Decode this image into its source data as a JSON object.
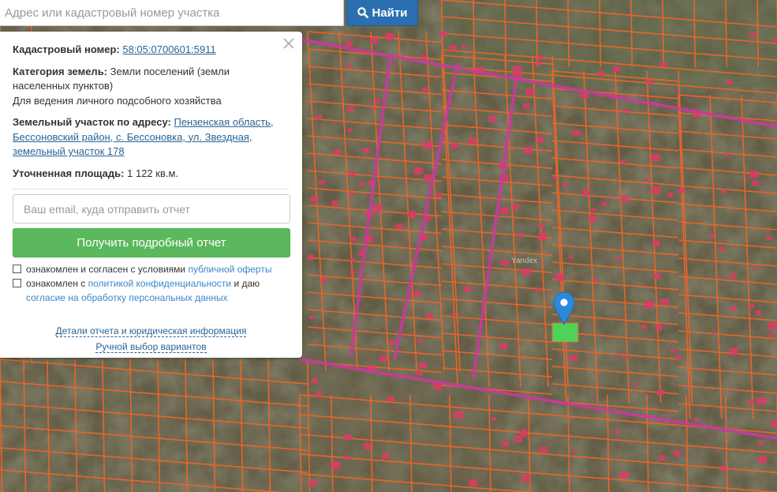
{
  "search": {
    "placeholder": "Адрес или кадастровый номер участка",
    "button_label": "Найти",
    "button_icon": "search-icon"
  },
  "info": {
    "cadastral_label": "Кадастровый номер:",
    "cadastral_value": "58:05:0700601:5911",
    "category_label": "Категория земель:",
    "category_value": "Земли поселений (земли населенных пунктов)",
    "usage": "Для ведения личного подсобного хозяйства",
    "address_label": "Земельный участок по адресу:",
    "address_value": "Пензенская область, Бессоновский район, с. Бессоновка, ул. Звездная, земельный участок 178",
    "area_label": "Уточненная площадь:",
    "area_value": "1 122 кв.м."
  },
  "form": {
    "email_placeholder": "Ваш email, куда отправить отчет",
    "submit_label": "Получить подробный отчет",
    "consent1_text": "ознакомлен и согласен с условиями",
    "consent1_link": "публичной оферты",
    "consent2_text_a": "ознакомлен с",
    "consent2_link_a": "политикой конфиденциальности",
    "consent2_text_b": "и даю",
    "consent2_link_b": "согласие на обработку персональных данных"
  },
  "links": {
    "details": "Детали отчета и юридическая информация",
    "manual": "Ручной выбор вариантов"
  },
  "map": {
    "watermark": "Yandex",
    "marker_icon": "location-pin-icon",
    "colors": {
      "parcel_border": "#e8652a",
      "road": "#c63c9a",
      "building": "#e03a66",
      "selected_parcel": "#4fd25a",
      "marker": "#2b8ad8"
    }
  },
  "colors": {
    "search_button": "#2b6fb0",
    "report_button": "#5cb85c",
    "link": "#2a6496"
  }
}
